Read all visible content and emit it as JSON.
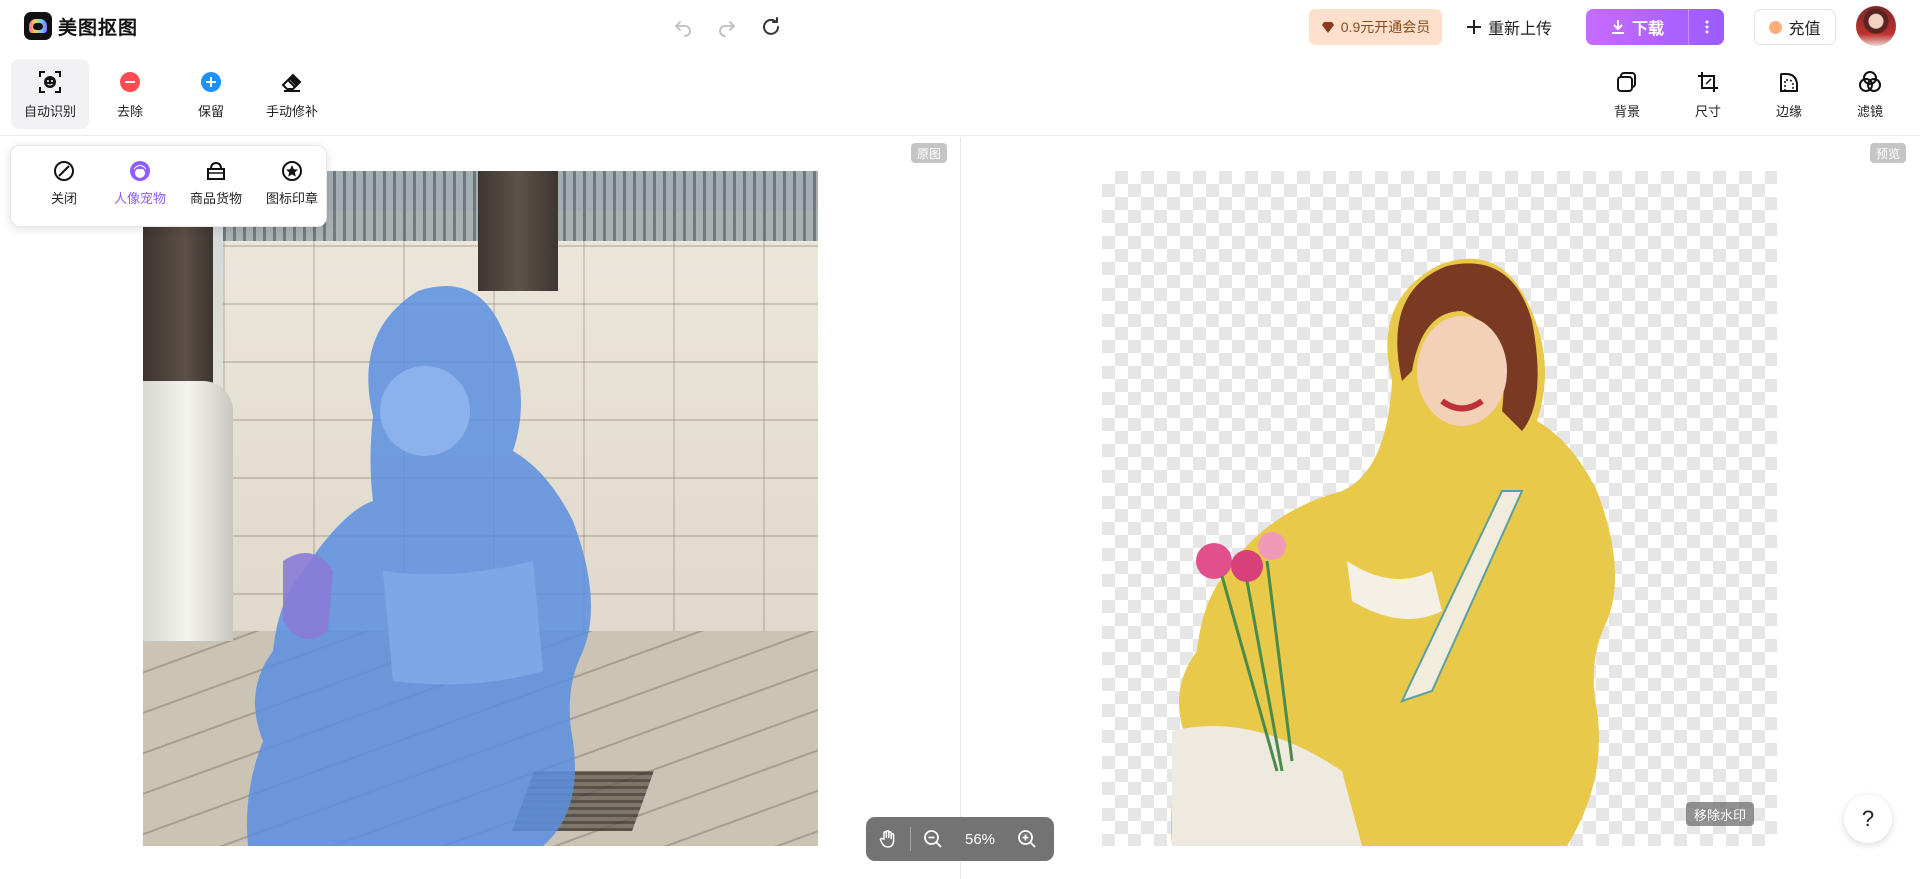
{
  "app": {
    "name": "美图抠图"
  },
  "header": {
    "undo_icon": "undo-icon",
    "redo_icon": "redo-icon",
    "reset_icon": "refresh-icon",
    "vip_label": "0.9元开通会员",
    "reupload_label": "重新上传",
    "download_label": "下载",
    "charge_label": "充值"
  },
  "toolbar": {
    "left_tools": [
      {
        "label": "自动识别",
        "icon": "auto-detect-icon",
        "active": true
      },
      {
        "label": "去除",
        "icon": "minus-circle-icon",
        "color": "#ff4d4f"
      },
      {
        "label": "保留",
        "icon": "plus-circle-icon",
        "color": "#1e90ff"
      },
      {
        "label": "手动修补",
        "icon": "eraser-icon"
      }
    ],
    "right_tools": [
      {
        "label": "背景",
        "icon": "background-icon"
      },
      {
        "label": "尺寸",
        "icon": "crop-icon"
      },
      {
        "label": "边缘",
        "icon": "edge-icon"
      },
      {
        "label": "滤镜",
        "icon": "filter-icon"
      }
    ]
  },
  "submenu": {
    "items": [
      {
        "label": "关闭",
        "icon": "close-circle-icon"
      },
      {
        "label": "人像宠物",
        "icon": "portrait-icon",
        "active": true
      },
      {
        "label": "商品货物",
        "icon": "bag-icon"
      },
      {
        "label": "图标印章",
        "icon": "star-badge-icon"
      }
    ]
  },
  "canvas": {
    "original_tag": "原图",
    "preview_tag": "预览",
    "remove_watermark_label": "移除水印",
    "zoom_value": "56%"
  },
  "help_label": "?",
  "colors": {
    "accent": "#9c5bff",
    "vip_bg": "#ffe0cc",
    "mask_blue": "#5b8fe0"
  }
}
